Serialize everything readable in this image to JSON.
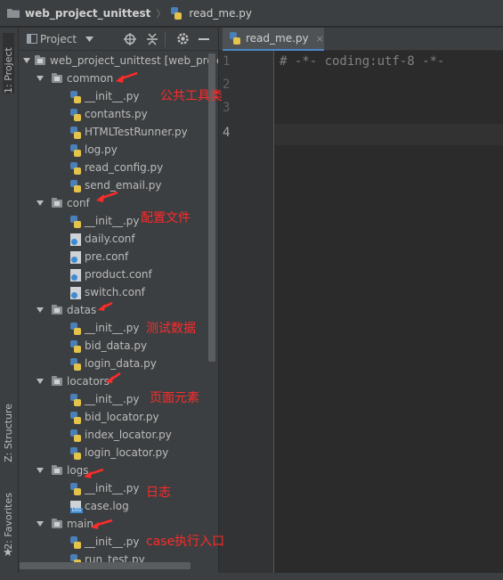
{
  "navbar": {
    "project": "web_project_unittest",
    "file": "read_me.py"
  },
  "side_tabs": {
    "project": "1: Project",
    "structure": "Z: Structure",
    "favorites": "2: Favorites"
  },
  "panel": {
    "title": "Project",
    "view_selector_icon": "chevron-down-icon",
    "tools": [
      "locate-icon",
      "collapse-icon",
      "gear-icon",
      "minimize-icon"
    ]
  },
  "tree": {
    "root": "web_project_unittest [web_proje",
    "common": {
      "name": "common",
      "files": [
        "__init__.py",
        "contants.py",
        "HTMLTestRunner.py",
        "log.py",
        "read_config.py",
        "send_email.py"
      ]
    },
    "conf": {
      "name": "conf",
      "files": [
        "__init__.py",
        "daily.conf",
        "pre.conf",
        "product.conf",
        "switch.conf"
      ]
    },
    "datas": {
      "name": "datas",
      "files": [
        "__init__.py",
        "bid_data.py",
        "login_data.py"
      ]
    },
    "locators": {
      "name": "locators",
      "files": [
        "__init__.py",
        "bid_locator.py",
        "index_locator.py",
        "login_locator.py"
      ]
    },
    "logs": {
      "name": "logs",
      "files": [
        "__init__.py",
        "case.log"
      ]
    },
    "main": {
      "name": "main",
      "files": [
        "__init__.py",
        "run_test.py"
      ]
    }
  },
  "editor": {
    "tab_label": "read_me.py",
    "close_glyph": "×",
    "line_numbers": [
      "1",
      "2",
      "3",
      "4"
    ],
    "current_line": 4,
    "lines": [
      "# -*- coding:utf-8 -*-",
      "",
      "",
      ""
    ]
  },
  "annotations": {
    "common": "公共工具类",
    "conf": "配置文件",
    "datas": "测试数据",
    "locators": "页面元素",
    "logs": "日志",
    "main": "case执行入口"
  },
  "colors": {
    "annotation": "#ff2a2a",
    "tab_underline": "#4a88c7",
    "panel_bg": "#3c3f41",
    "editor_bg": "#2b2b2b"
  }
}
